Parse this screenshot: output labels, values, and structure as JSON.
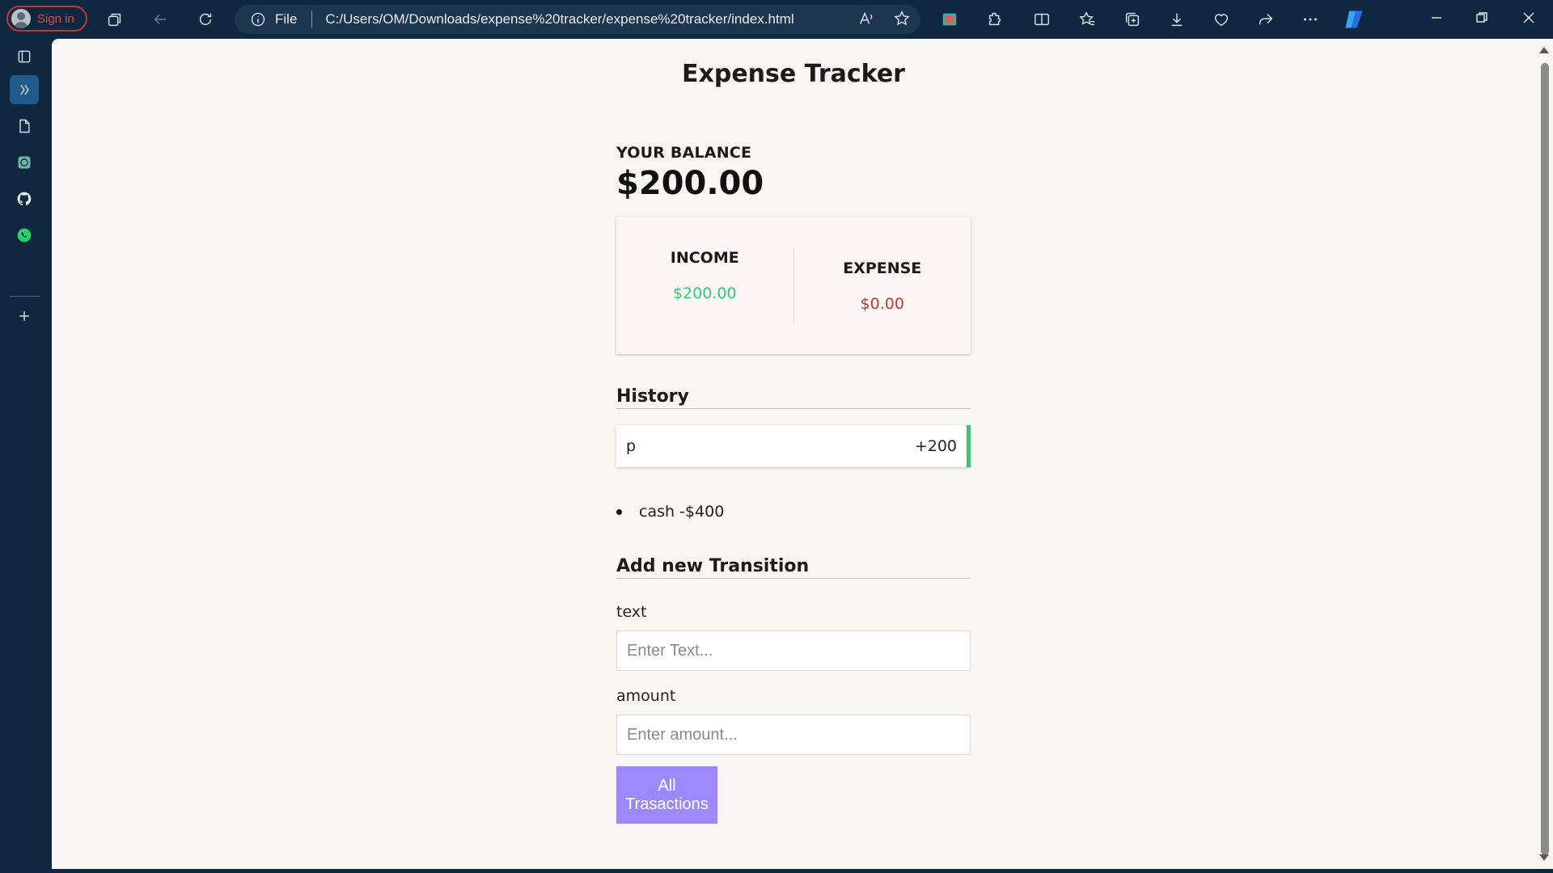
{
  "browser": {
    "profile_label": "Sign in",
    "address_prefix": "File",
    "url": "C:/Users/OM/Downloads/expense%20tracker/expense%20tracker/index.html"
  },
  "app": {
    "title": "Expense Tracker",
    "balance": {
      "label": "YOUR BALANCE",
      "value": "$200.00"
    },
    "income": {
      "label": "INCOME",
      "value": "$200.00"
    },
    "expense": {
      "label": "EXPENSE",
      "value": "$0.00"
    },
    "history": {
      "heading": "History",
      "items": [
        {
          "text": "p",
          "amount": "+200",
          "type": "plus"
        }
      ],
      "extra_list": [
        "cash -$400"
      ]
    },
    "form": {
      "heading": "Add new Transition",
      "text_label": "text",
      "text_placeholder": "Enter Text...",
      "amount_label": "amount",
      "amount_placeholder": "Enter amount...",
      "submit_label": "All Trasactions"
    }
  },
  "colors": {
    "income": "#2ecc71",
    "expense": "#c0392b",
    "button": "#9c88ff",
    "chrome": "#0f2840"
  }
}
